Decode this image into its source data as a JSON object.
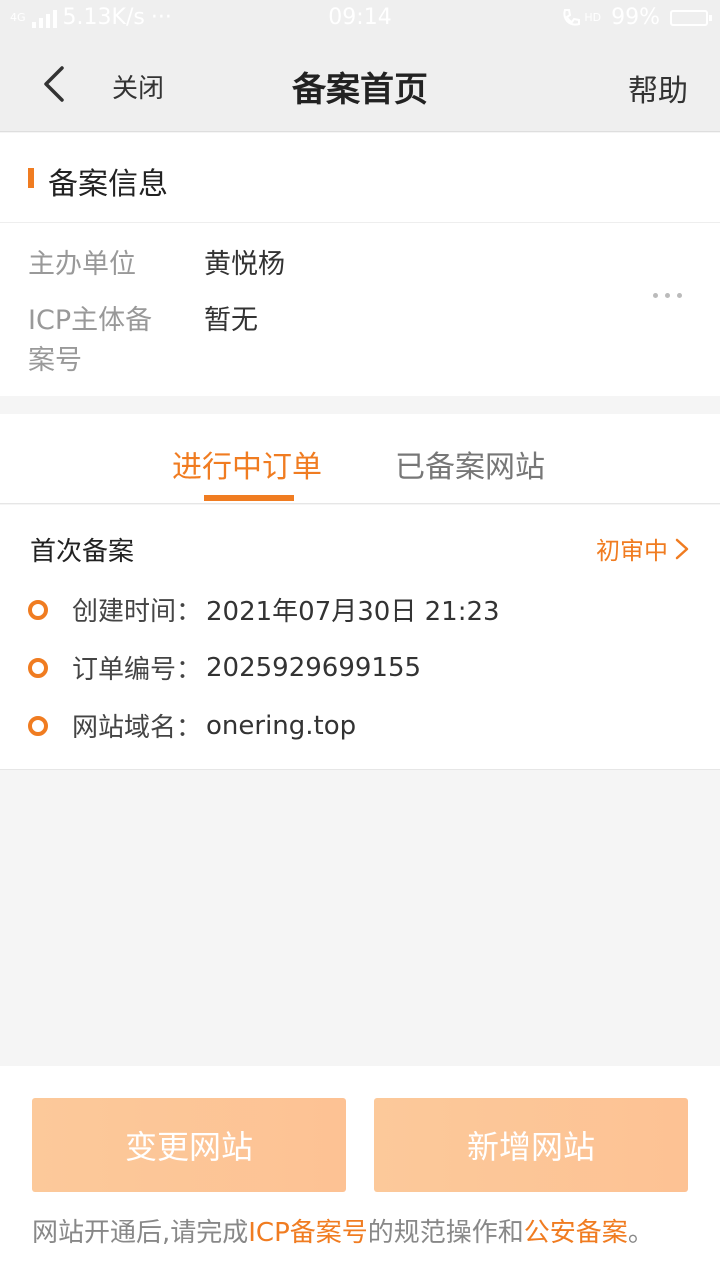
{
  "status_bar": {
    "network": "4G",
    "speed": "5.13K/s",
    "more": "···",
    "time": "09:14",
    "hd": "HD",
    "battery": "99%",
    "battery_level": 0.99
  },
  "nav": {
    "close_label": "关闭",
    "title": "备案首页",
    "help_label": "帮助"
  },
  "info": {
    "section_title": "备案信息",
    "sponsor_label": "主办单位",
    "sponsor_value": "黄悦杨",
    "icp_label": "ICP主体备案号",
    "icp_value": "暂无"
  },
  "tabs": [
    {
      "label": "进行中订单",
      "active": true
    },
    {
      "label": "已备案网站",
      "active": false
    }
  ],
  "order": {
    "type": "首次备案",
    "status": "初审中",
    "fields": [
      {
        "label": "创建时间：",
        "value": "2021年07月30日 21:23"
      },
      {
        "label": "订单编号：",
        "value": "2025929699155"
      },
      {
        "label": "网站域名：",
        "value": "onering.top"
      }
    ]
  },
  "actions": {
    "change_label": "变更网站",
    "add_label": "新增网站"
  },
  "notice": {
    "prefix": "网站开通后,请完成",
    "link1": "ICP备案号",
    "middle": "的规范操作和",
    "link2": "公安备案",
    "suffix": "。"
  },
  "colors": {
    "accent": "#f07c21",
    "button_bg": "#fdc79a",
    "page_bg": "#f5f5f5"
  }
}
